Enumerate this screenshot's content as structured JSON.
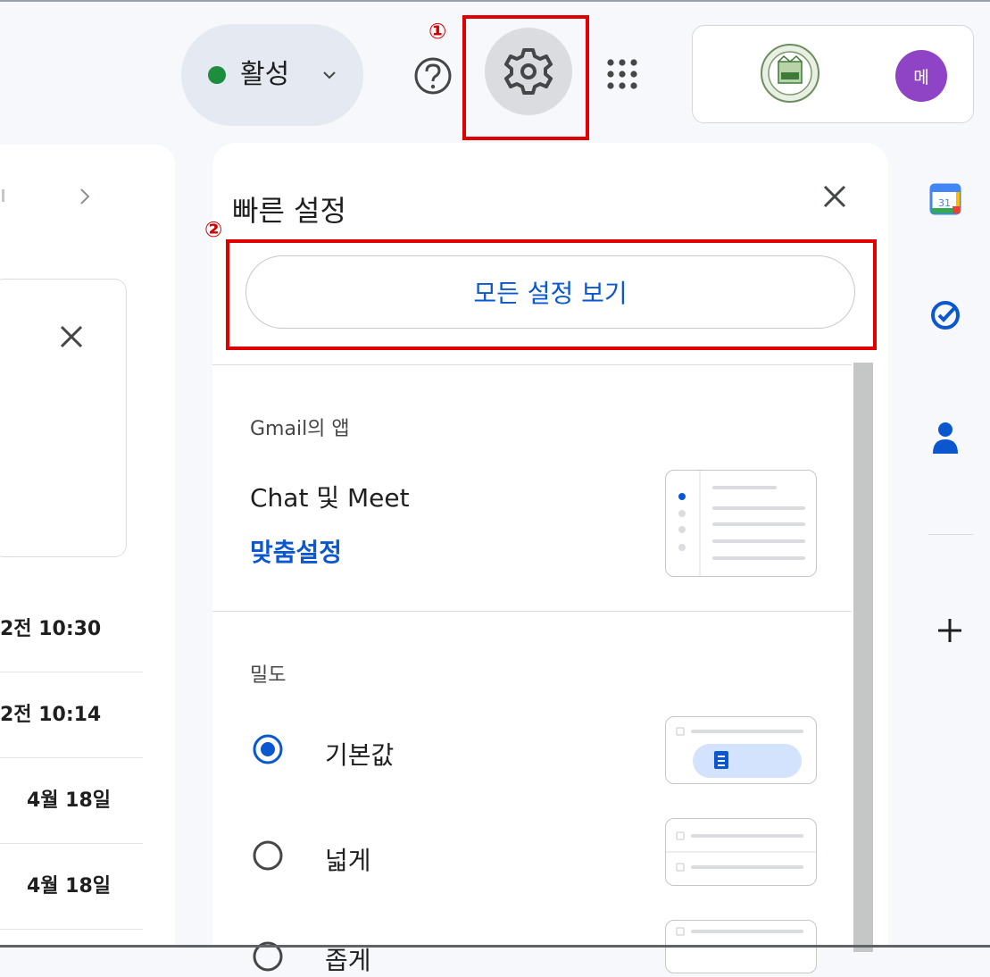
{
  "header": {
    "status_label": "활성",
    "avatar_initial": "메"
  },
  "annotations": {
    "step1": "①",
    "step2": "②"
  },
  "quick_settings": {
    "title": "빠른 설정",
    "all_settings_button": "모든 설정 보기",
    "apps_section": {
      "heading": "Gmail의 앱",
      "chat_meet_label": "Chat 및 Meet",
      "customize_link": "맞춤설정"
    },
    "density_section": {
      "heading": "밀도",
      "options": [
        {
          "label": "기본값",
          "selected": true
        },
        {
          "label": "넓게",
          "selected": false
        },
        {
          "label": "좁게",
          "selected": false
        }
      ]
    }
  },
  "mail_list": {
    "times": [
      "2전 10:30",
      "2전 10:14",
      "4월 18일",
      "4월 18일"
    ]
  },
  "colors": {
    "accent_blue": "#0b57d0",
    "status_green": "#1e8e3e",
    "annotation_red": "#e00000",
    "avatar_purple": "#8e44c5"
  },
  "icons": [
    "chevron-down-icon",
    "help-icon",
    "gear-icon",
    "apps-grid-icon",
    "close-icon",
    "calendar-icon",
    "tasks-icon",
    "contacts-icon",
    "add-icon"
  ]
}
